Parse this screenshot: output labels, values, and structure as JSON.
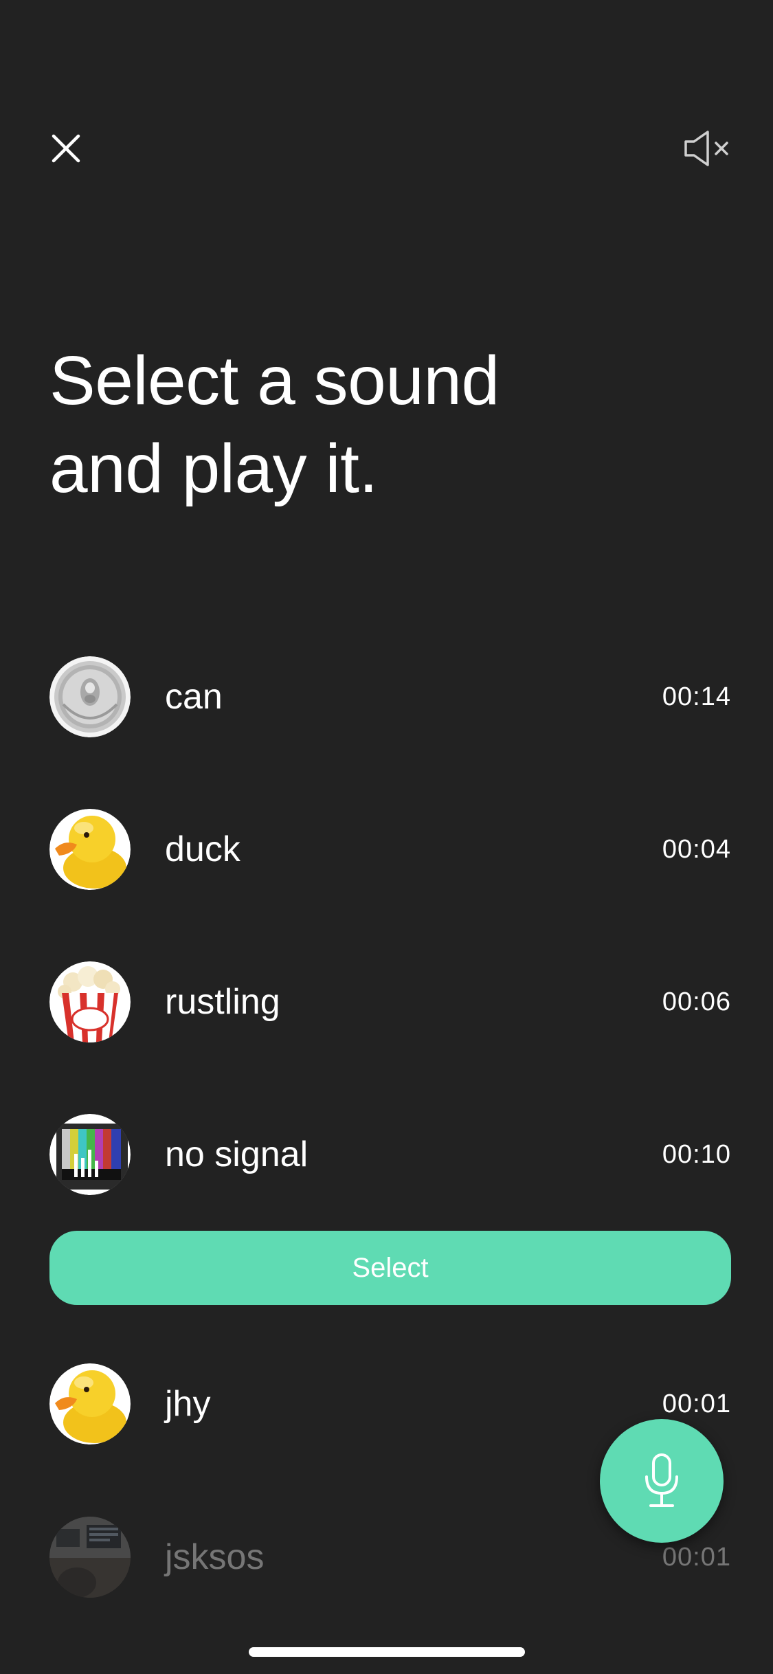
{
  "header": {
    "close_icon": "close-icon",
    "mute_icon": "speaker-muted-icon"
  },
  "headline": {
    "line1": "Select a sound",
    "line2": "and play it."
  },
  "sounds": [
    {
      "name": "can",
      "duration": "00:14",
      "icon": "soda-can-icon"
    },
    {
      "name": "duck",
      "duration": "00:04",
      "icon": "rubber-duck-icon"
    },
    {
      "name": "rustling",
      "duration": "00:06",
      "icon": "popcorn-icon"
    },
    {
      "name": "no signal",
      "duration": "00:10",
      "icon": "tv-test-pattern-icon"
    },
    {
      "name": "jhy",
      "duration": "00:01",
      "icon": "rubber-duck-icon"
    },
    {
      "name": "jsksos",
      "duration": "00:01",
      "icon": "photo-thumbnail-icon"
    }
  ],
  "select_button": {
    "label": "Select"
  },
  "mic_button": {
    "icon": "microphone-icon"
  },
  "colors": {
    "background": "#222222",
    "accent": "#5fdbb3",
    "text": "#ffffff"
  }
}
